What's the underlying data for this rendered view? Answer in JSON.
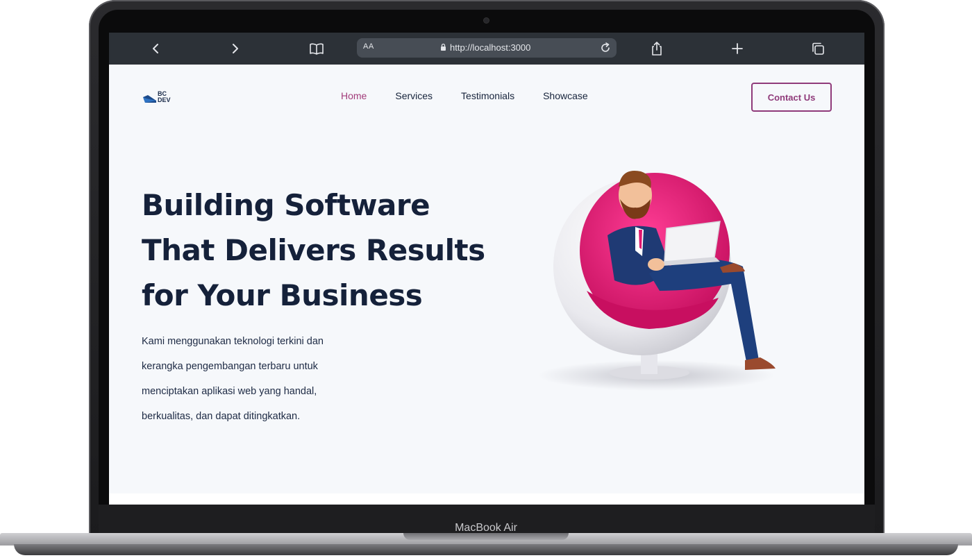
{
  "device": {
    "label": "MacBook Air"
  },
  "browser": {
    "text_size_label": "AA",
    "url": "http://localhost:3000",
    "icons": [
      "back-icon",
      "forward-icon",
      "bookmarks-icon",
      "lock-icon",
      "reload-icon",
      "share-icon",
      "new-tab-icon",
      "tabs-icon"
    ]
  },
  "site": {
    "logo_line1": "BC",
    "logo_line2": "DEV",
    "nav": [
      {
        "label": "Home",
        "active": true
      },
      {
        "label": "Services",
        "active": false
      },
      {
        "label": "Testimonials",
        "active": false
      },
      {
        "label": "Showcase",
        "active": false
      }
    ],
    "contact_label": "Contact Us",
    "headline_lines": [
      "Building Software",
      "That Delivers Results",
      "for Your Business"
    ],
    "description_lines": [
      "Kami menggunakan teknologi terkini dan",
      "kerangka pengembangan terbaru untuk",
      "menciptakan aplikasi web yang handal,",
      "berkualitas, dan dapat ditingkatkan."
    ]
  },
  "colors": {
    "accent": "#a23c7a",
    "heading": "#15213a",
    "page_bg": "#f6f8fb",
    "browser_bar": "#2c3137",
    "chair_pink": "#e0156f"
  }
}
